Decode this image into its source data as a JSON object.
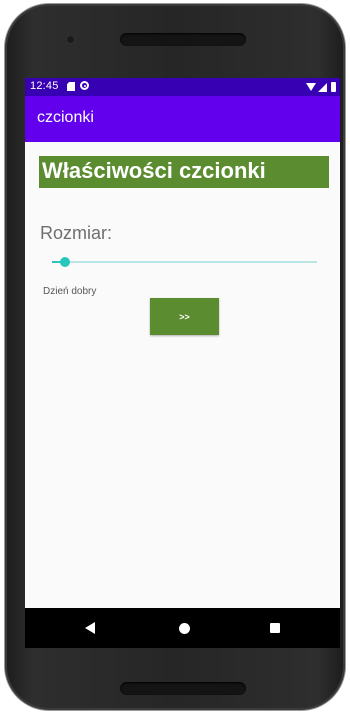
{
  "status_bar": {
    "time": "12:45",
    "icons": [
      "sd-card-icon",
      "sync-icon",
      "wifi-icon",
      "signal-icon",
      "battery-icon"
    ]
  },
  "app_bar": {
    "title": "czcionki"
  },
  "main": {
    "header": "Właściwości czcionki",
    "size_label": "Rozmiar:",
    "size_slider": {
      "value_fraction": 0.05
    },
    "greeting_text": "Dzień dobry",
    "next_button_label": ">>"
  },
  "nav_bar": {
    "icons": [
      "back-icon",
      "home-icon",
      "recents-icon"
    ]
  },
  "colors": {
    "status_bar": "#3700b3",
    "app_bar": "#6200ee",
    "accent_green": "#5b8c2f",
    "slider_teal": "#26c6bd",
    "background": "#fafafa"
  }
}
